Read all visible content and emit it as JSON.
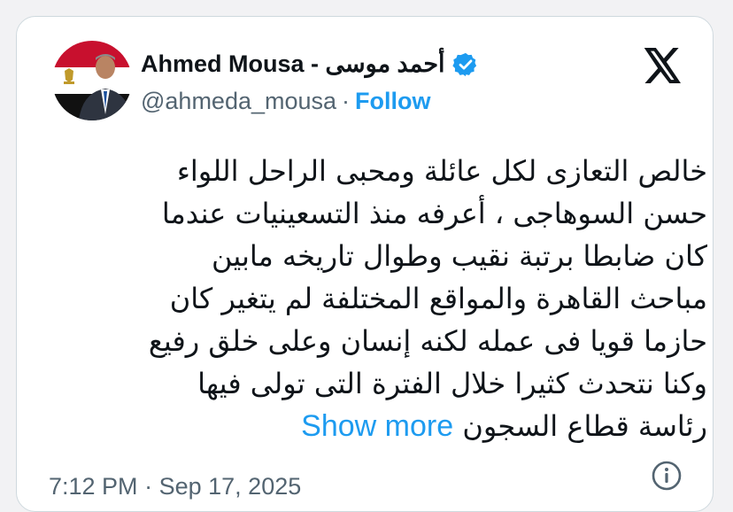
{
  "author": {
    "name": "Ahmed Mousa - أحمد موسى",
    "handle": "@ahmeda_mousa",
    "separator": "·",
    "follow_label": "Follow"
  },
  "icons": {
    "verified": "verified-badge-icon",
    "platform": "x-logo-icon",
    "info": "info-icon"
  },
  "colors": {
    "accent": "#1d9bf0",
    "text": "#0f1419",
    "secondary": "#536471"
  },
  "tweet": {
    "lines": [
      "خالص التعازى لكل عائلة ومحبى الراحل اللواء",
      "حسن السوهاجى ، أعرفه منذ التسعينيات عندما",
      "كان ضابطا برتبة نقيب وطوال تاريخه مابين",
      "مباحث القاهرة والمواقع  المختلفة لم يتغير كان",
      "حازما قويا فى عمله لكنه إنسان وعلى خلق رفيع",
      "وكنا نتحدث كثيرا خلال الفترة التى تولى فيها",
      "رئاسة قطاع السجون"
    ],
    "show_more": "Show more"
  },
  "meta": {
    "time": "7:12 PM",
    "separator": "·",
    "date": "Sep 17, 2025"
  }
}
